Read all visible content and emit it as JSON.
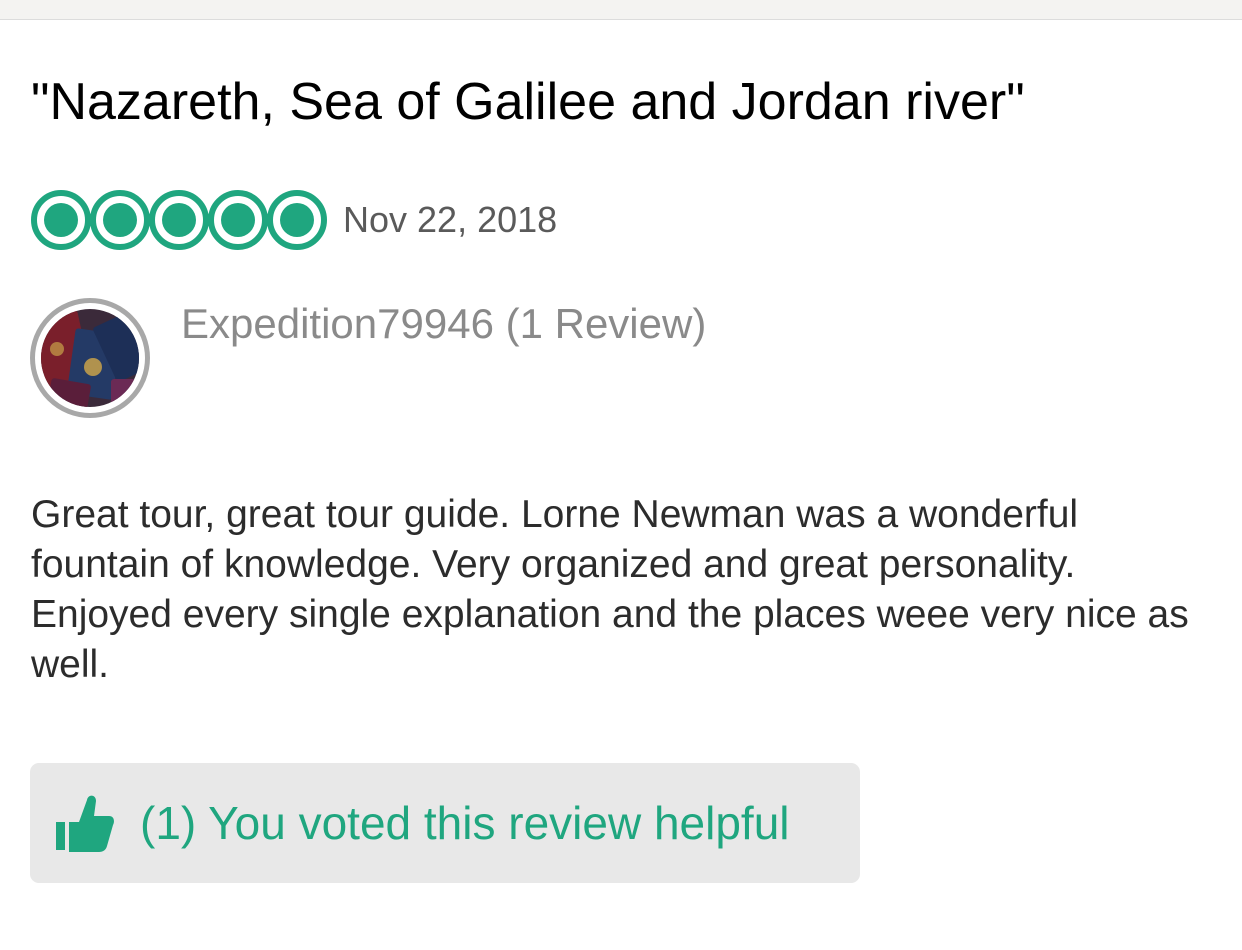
{
  "review": {
    "title": "\"Nazareth, Sea of Galilee and Jordan river\"",
    "rating": 5,
    "rating_max": 5,
    "rating_icon": "bubble-rating-icon",
    "date": "Nov 22, 2018",
    "author": "Expedition79946 (1 Review)",
    "avatar_icon": "passport-avatar",
    "body": "Great tour, great tour guide. Lorne Newman was a wonderful fountain of knowledge. Very organized and great personality. Enjoyed every single explanation and the places weee very nice as well.",
    "helpful": {
      "label": "(1) You voted this review helpful",
      "icon": "thumbs-up-icon"
    }
  },
  "colors": {
    "accent": "#1fa67f",
    "button_bg": "#e8e8e8",
    "muted_text": "#8a8a8a",
    "body_text": "#2c2c2c"
  }
}
